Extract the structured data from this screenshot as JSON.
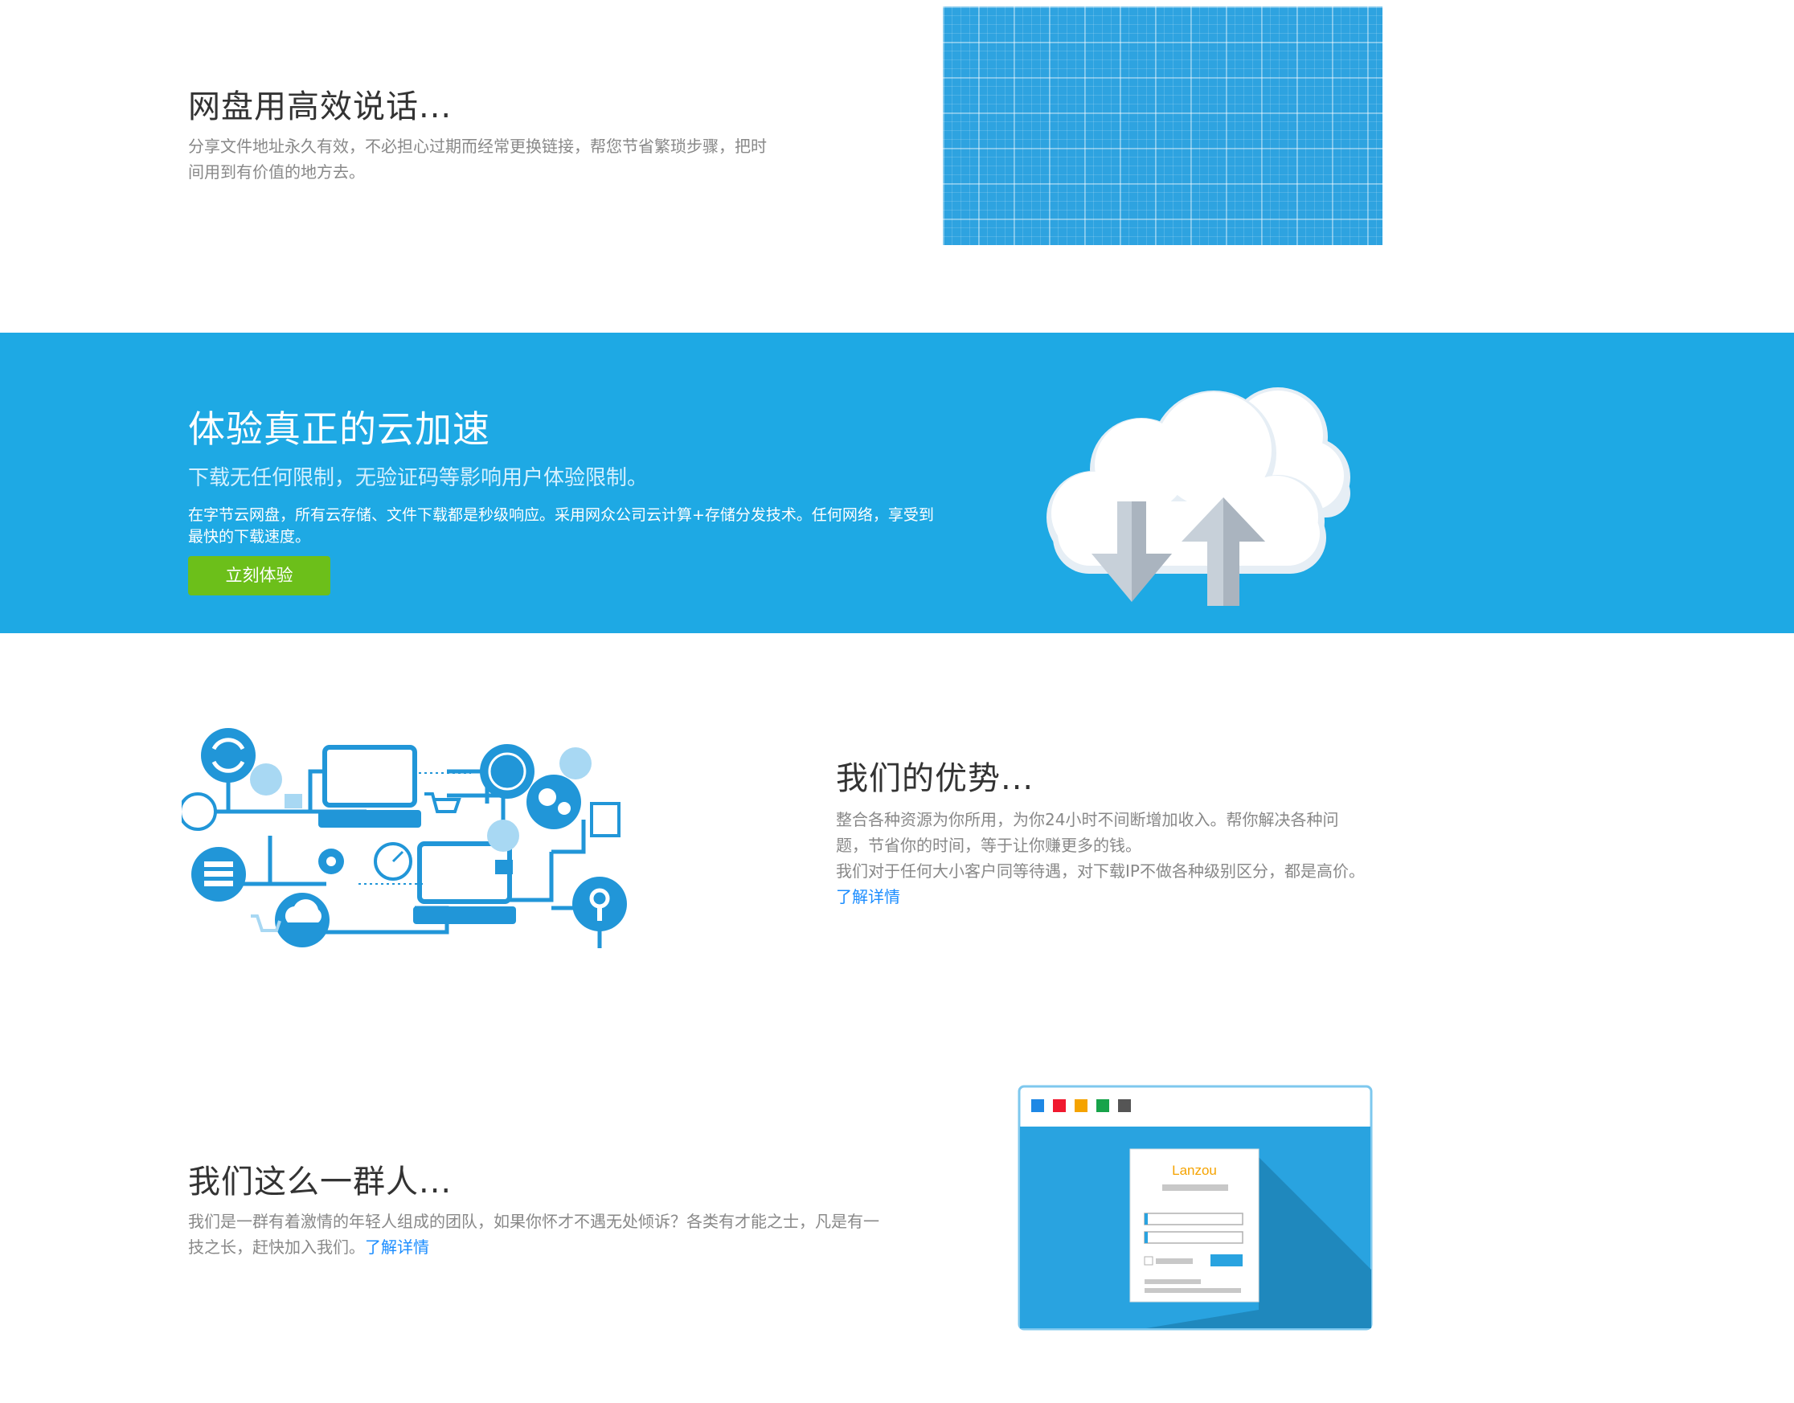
{
  "sec1": {
    "title": "网盘用高效说话...",
    "desc": "分享文件地址永久有效，不必担心过期而经常更换链接，帮您节省繁琐步骤，把时间用到有价值的地方去。"
  },
  "sec2": {
    "title": "体验真正的云加速",
    "subtitle": "下载无任何限制，无验证码等影响用户体验限制。",
    "desc": "在字节云网盘，所有云存储、文件下载都是秒级响应。采用网众公司云计算+存储分发技术。任何网络，享受到最快的下载速度。",
    "button": "立刻体验"
  },
  "sec3": {
    "title": "我们的优势...",
    "desc1": "整合各种资源为你所用，为你24小时不间断增加收入。帮你解决各种问题，节省你的时间，等于让你赚更多的钱。",
    "desc2": "我们对于任何大小客户同等待遇，对下载IP不做各种级别区分，都是高价。",
    "link": "了解详情"
  },
  "sec4": {
    "title": "我们这么一群人...",
    "desc": "我们是一群有着激情的年轻人组成的团队，如果你怀才不遇无处倾诉？各类有才能之士，凡是有一技之长，赶快加入我们。",
    "link": "了解详情",
    "logo": "Lanzou"
  },
  "colors": {
    "band": "#1ea9e4",
    "button": "#6cbf1a",
    "link": "#1a8cff",
    "dots": [
      "#1e88e5",
      "#f0192f",
      "#f5a300",
      "#17a34a",
      "#555555"
    ]
  }
}
